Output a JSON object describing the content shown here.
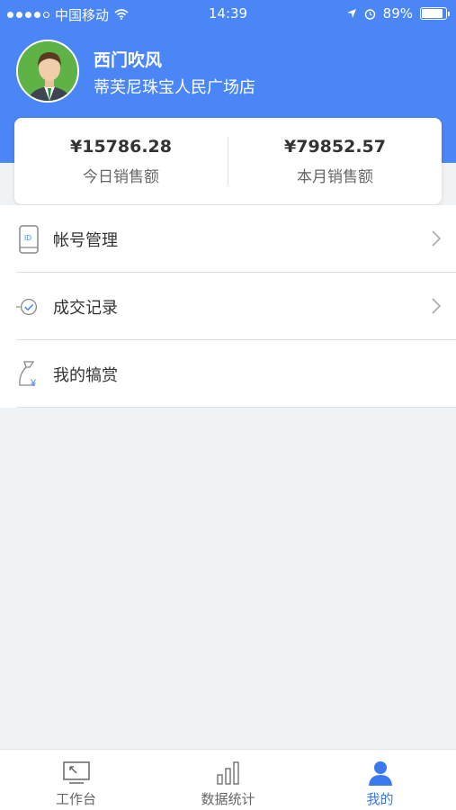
{
  "status_bar": {
    "carrier": "中国移动",
    "time": "14:39",
    "battery_text": "89%",
    "battery_level": 0.89
  },
  "profile": {
    "name": "西门吹风",
    "store": "蒂芙尼珠宝人民广场店",
    "avatar_icon": "user-avatar-icon"
  },
  "sales": {
    "today_value": "¥15786.28",
    "today_label": "今日销售额",
    "month_value": "¥79852.57",
    "month_label": "本月销售额"
  },
  "menu": [
    {
      "label": "帐号管理",
      "icon": "id-card-icon",
      "chevron": true
    },
    {
      "label": "成交记录",
      "icon": "check-circle-icon",
      "chevron": true
    },
    {
      "label": "我的犒赏",
      "icon": "money-bag-icon",
      "chevron": false
    }
  ],
  "tabs": [
    {
      "label": "工作台",
      "icon": "monitor-icon",
      "active": false
    },
    {
      "label": "数据统计",
      "icon": "bar-chart-icon",
      "active": false
    },
    {
      "label": "我的",
      "icon": "person-icon",
      "active": true
    }
  ],
  "colors": {
    "brand_blue": "#4a86f6",
    "active_tab": "#3a78f0",
    "background": "#eff3f5",
    "avatar_bg": "#5fb346"
  }
}
